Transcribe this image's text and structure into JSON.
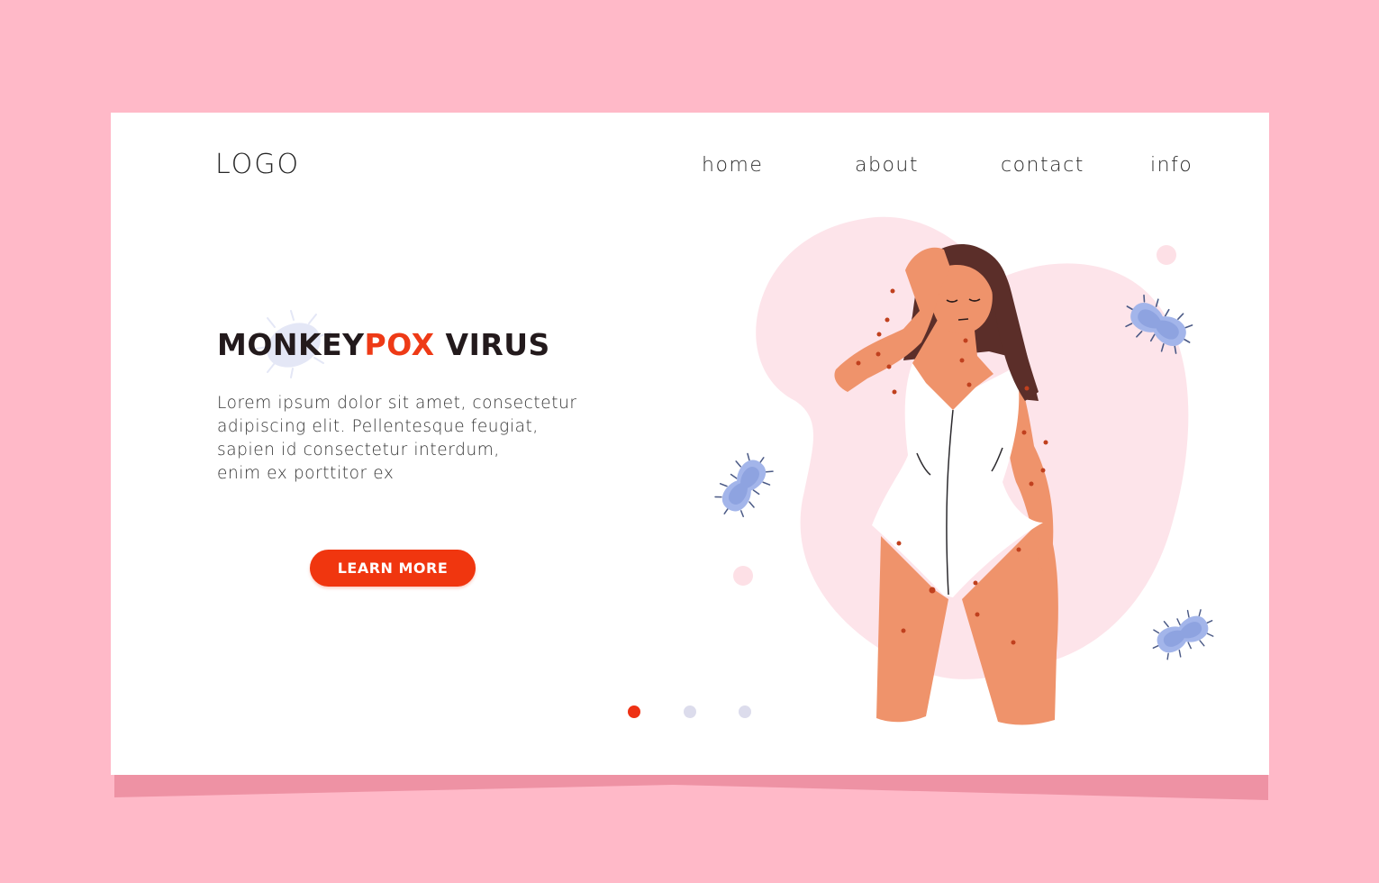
{
  "colors": {
    "page_background": "#ffb9c8",
    "card_shadow": "#ee92a4",
    "card": "#ffffff",
    "accent": "#ee3a16",
    "title_dark": "#231a1c",
    "dot_inactive": "#dcdcec",
    "blob": "#fde4ea",
    "skin": "#ef936b",
    "hair": "#5b2e29",
    "rash": "#c0401e",
    "virus": "#a3b5ea"
  },
  "header": {
    "logo": "LOGO",
    "nav": [
      {
        "label": "home"
      },
      {
        "label": "about"
      },
      {
        "label": "contact"
      },
      {
        "label": "info"
      }
    ]
  },
  "hero": {
    "title_part1": "MONKEY",
    "title_accent": "POX",
    "title_part2": " VIRUS",
    "body_lines": [
      "Lorem ipsum dolor sit amet, consectetur",
      "adipiscing elit. Pellentesque feugiat,",
      "sapien id consectetur interdum,",
      "enim ex porttitor ex"
    ],
    "cta_label": "LEARN MORE"
  },
  "carousel": {
    "slides": 3,
    "active_index": 0
  },
  "illustration": {
    "description": "woman in white swimsuit with rash holding forehead, virus particles"
  }
}
